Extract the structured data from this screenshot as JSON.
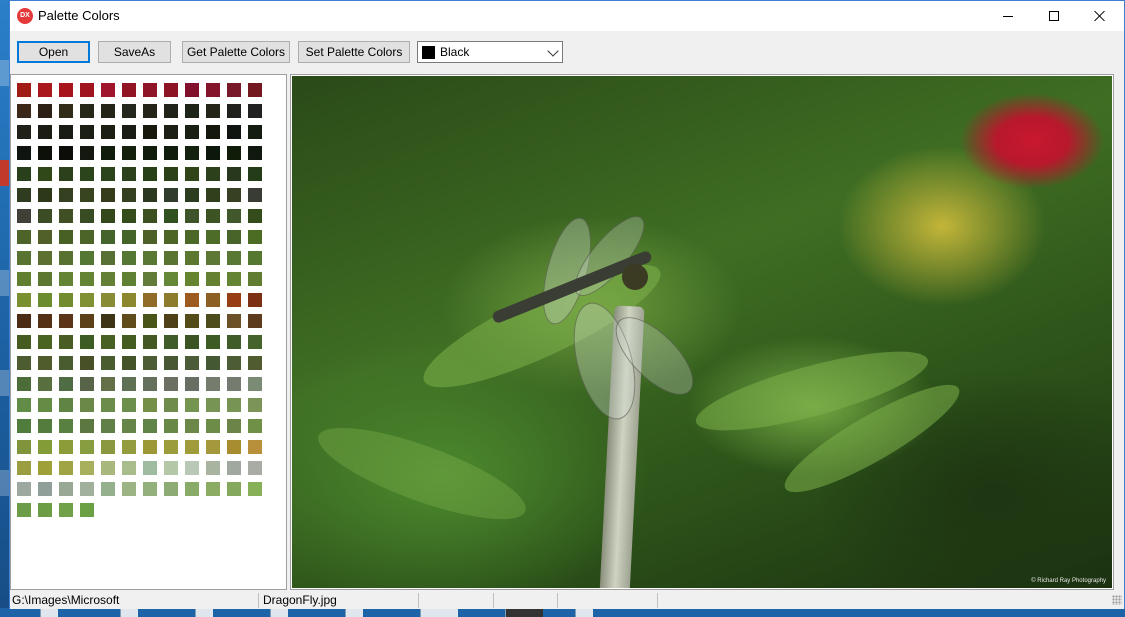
{
  "window": {
    "title": "Palette Colors",
    "app_icon_text": "DX",
    "controls": [
      "minimize",
      "maximize",
      "close"
    ]
  },
  "toolbar": {
    "open_label": "Open",
    "saveas_label": "SaveAs",
    "get_palette_label": "Get Palette Colors",
    "set_palette_label": "Set Palette Colors",
    "color_select": {
      "value": "Black",
      "swatch": "#000000"
    }
  },
  "palette": {
    "columns": 12,
    "colors": [
      "#a01c14",
      "#a8181c",
      "#a8141c",
      "#a01420",
      "#a0142c",
      "#901424",
      "#901428",
      "#8c1424",
      "#80102c",
      "#84142c",
      "#781828",
      "#741820",
      "#3c2818",
      "#2c2014",
      "#302c18",
      "#282818",
      "#242418",
      "#24281c",
      "#242418",
      "#202418",
      "#1c2418",
      "#242418",
      "#20201c",
      "#202020",
      "#202018",
      "#1c1c14",
      "#181c14",
      "#1c2014",
      "#1c2014",
      "#181c14",
      "#18180c",
      "#1c2014",
      "#182014",
      "#14180c",
      "#101410",
      "#141c10",
      "#101410",
      "#0c1008",
      "#0c0c08",
      "#141810",
      "#101c0c",
      "#14200c",
      "#101c0c",
      "#101c0c",
      "#142010",
      "#0c180c",
      "#101c08",
      "#101810",
      "#28401c",
      "#304818",
      "#2c401c",
      "#2c441c",
      "#2c441c",
      "#2c401c",
      "#284018",
      "#2c4018",
      "#304418",
      "#2c401c",
      "#28381c",
      "#243c18",
      "#303c20",
      "#2c3818",
      "#344020",
      "#384420",
      "#343c1c",
      "#344020",
      "#2c3820",
      "#303c2c",
      "#2c3c20",
      "#30401c",
      "#384024",
      "#383c34",
      "#404038",
      "#3c4c24",
      "#405024",
      "#384c24",
      "#34481c",
      "#344c1c",
      "#3c5020",
      "#305020",
      "#3c5428",
      "#3c5424",
      "#40582c",
      "#344c1c",
      "#4c6428",
      "#506028",
      "#486024",
      "#4c6428",
      "#44642c",
      "#446428",
      "#4c6028",
      "#4c6424",
      "#4c6828",
      "#4c6c28",
      "#486428",
      "#4c6c24",
      "#587430",
      "#5c7030",
      "#587030",
      "#547834",
      "#587034",
      "#547834",
      "#587834",
      "#587430",
      "#5c7830",
      "#5c7834",
      "#587834",
      "#547830",
      "#608030",
      "#5c7830",
      "#648434",
      "#648434",
      "#648034",
      "#608034",
      "#607c38",
      "#648838",
      "#648430",
      "#648030",
      "#648434",
      "#607c30",
      "#789030",
      "#6c8c30",
      "#748c30",
      "#809034",
      "#888c34",
      "#8c8830",
      "#906c28",
      "#8c7c2c",
      "#9c5c20",
      "#8c6024",
      "#983c14",
      "#7c3014",
      "#4c2c14",
      "#543014",
      "#5c3418",
      "#5c4018",
      "#3c3414",
      "#604c18",
      "#485418",
      "#504018",
      "#544c18",
      "#4c4c1c",
      "#6c5028",
      "#5c3c1c",
      "#445c20",
      "#486420",
      "#485c24",
      "#3c5c24",
      "#486024",
      "#445c20",
      "#445824",
      "#405c28",
      "#3c5424",
      "#3c5c24",
      "#405c28",
      "#44642c",
      "#4c5c30",
      "#505c2c",
      "#485c30",
      "#485028",
      "#485c30",
      "#445428",
      "#4c5c34",
      "#485834",
      "#4c5c38",
      "#445834",
      "#4c5c34",
      "#505c30",
      "#4c6c38",
      "#587040",
      "#506c44",
      "#586448",
      "#647048",
      "#607054",
      "#64705c",
      "#6c7060",
      "#687064",
      "#747c6c",
      "#747c70",
      "#7c8c74",
      "#608c48",
      "#648c44",
      "#608444",
      "#6c8848",
      "#6c8c4c",
      "#6c904c",
      "#749048",
      "#708c4c",
      "#749450",
      "#789454",
      "#789454",
      "#7c9458",
      "#507c3c",
      "#547c3c",
      "#588040",
      "#5c7840",
      "#608048",
      "#648448",
      "#608448",
      "#688848",
      "#6c8848",
      "#6c8c48",
      "#6c8448",
      "#709048",
      "#80943c",
      "#849c38",
      "#8c9c38",
      "#889c40",
      "#8c9840",
      "#949c40",
      "#9c9838",
      "#9c9c3c",
      "#a09c3c",
      "#a4983c",
      "#a88c30",
      "#b8903c",
      "#9c9c40",
      "#a0a038",
      "#a0a444",
      "#a8b05c",
      "#a8b87c",
      "#a8bc8c",
      "#a0bca0",
      "#b4c8a8",
      "#b8c8b4",
      "#a8b4a0",
      "#a0a8a0",
      "#a8aca4",
      "#9ca8a0",
      "#90a098",
      "#98a894",
      "#a0b09c",
      "#94b08c",
      "#9cb484",
      "#94b07c",
      "#8cac74",
      "#88ac68",
      "#8cac64",
      "#84a85c",
      "#88b058",
      "#6c9c48",
      "#6c9c44",
      "#70a048",
      "#6ca044"
    ]
  },
  "image": {
    "alt": "Dragonfly perched on a stem",
    "watermark": "© Richard Ray Photography"
  },
  "statusbar": {
    "path": "G:\\Images\\Microsoft",
    "file": "DragonFly.jpg"
  }
}
